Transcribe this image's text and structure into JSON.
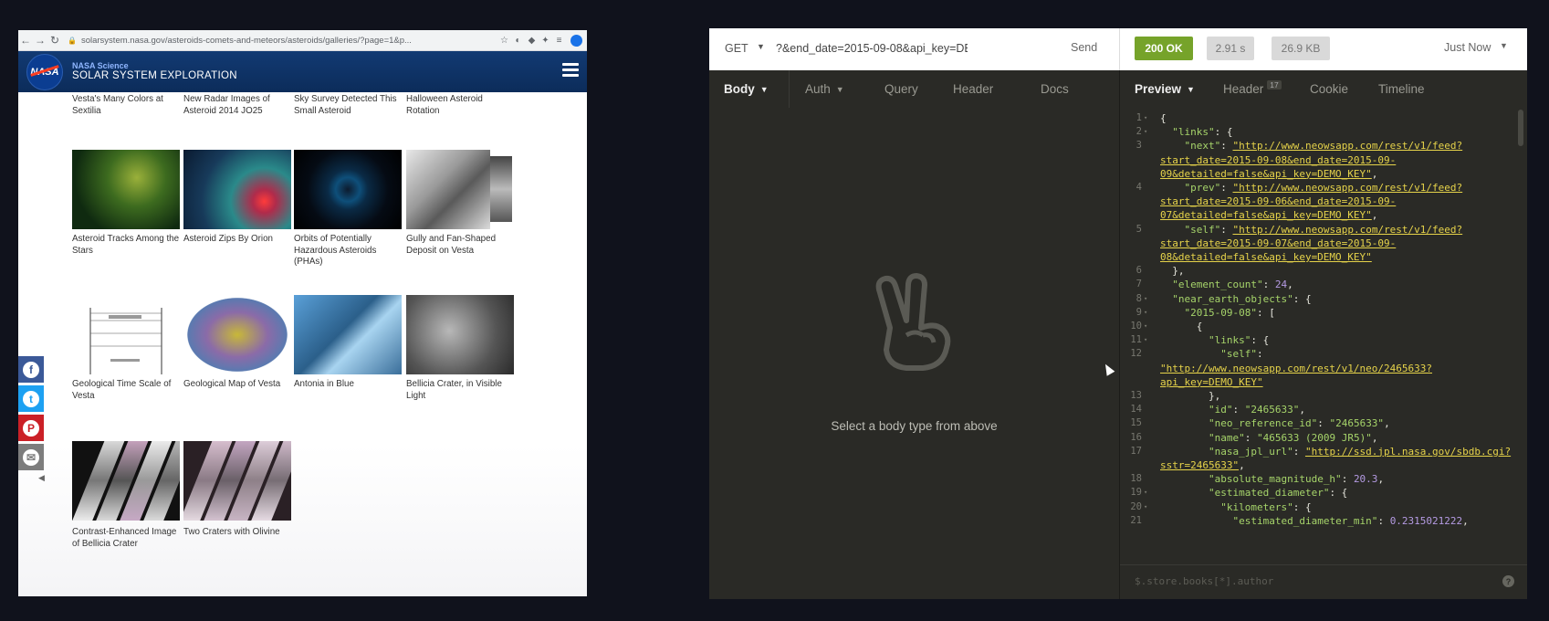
{
  "browser": {
    "url": "solarsystem.nasa.gov/asteroids-comets-and-meteors/asteroids/galleries/?page=1&p...",
    "nasa_kicker": "NASA Science",
    "site_title": "SOLAR SYSTEM EXPLORATION",
    "logo_text": "NASA",
    "top_captions": [
      "Vesta's Many Colors at Sextilia",
      "New Radar Images of Asteroid 2014 JO25",
      "Sky Survey Detected This Small Asteroid",
      "Halloween Asteroid Rotation"
    ],
    "row1_captions": [
      "Asteroid Tracks Among the Stars",
      "Asteroid Zips By Orion",
      "Orbits of Potentially Hazardous Asteroids (PHAs)",
      "Gully and Fan-Shaped Deposit on Vesta"
    ],
    "row2_captions": [
      "Geological Time Scale of Vesta",
      "Geological Map of Vesta",
      "Antonia in Blue",
      "Bellicia Crater, in Visible Light"
    ],
    "row3_captions": [
      "Contrast-Enhanced Image of Bellicia Crater",
      "Two Craters with Olivine"
    ],
    "share": {
      "facebook": "f",
      "twitter": "t",
      "pinterest": "P",
      "email": "✉",
      "collapse": "◀"
    },
    "colors": {
      "facebook": "#3b5998",
      "twitter": "#1da1f2",
      "pinterest": "#cb2027",
      "email": "#7d7d7d"
    }
  },
  "insomnia": {
    "method": "GET",
    "url": "?&end_date=2015-09-08&api_key=DEMO_KEY",
    "send": "Send",
    "status": "200 OK",
    "time": "2.91 s",
    "size": "26.9 KB",
    "timestamp": "Just Now",
    "request_tabs": [
      "Body",
      "Auth",
      "Query",
      "Header",
      "Docs"
    ],
    "response_tabs": [
      "Preview",
      "Header",
      "Cookie",
      "Timeline"
    ],
    "header_count": "17",
    "empty_message": "Select a body type from above",
    "filter_placeholder": "$.store.books[*].author",
    "help": "?",
    "colors": {
      "status_ok": "#76a32a",
      "json_key": "#a6d46a",
      "json_link": "#e6d34a",
      "json_number": "#b59be3"
    },
    "json_lines": [
      {
        "n": "1",
        "fold": "▾",
        "html": "{"
      },
      {
        "n": "2",
        "fold": "▾",
        "html": "  <span class='k'>\"links\"</span>: {"
      },
      {
        "n": "3",
        "fold": "",
        "html": "    <span class='k'>\"next\"</span>: <span class='u'>\"http://www.neowsapp.com/rest/v1/feed?</span>"
      },
      {
        "n": "",
        "fold": "",
        "html": "<span class='u'>start_date=2015-09-08&end_date=2015-09-</span>"
      },
      {
        "n": "",
        "fold": "",
        "html": "<span class='u'>09&detailed=false&api_key=DEMO_KEY\"</span>,"
      },
      {
        "n": "4",
        "fold": "",
        "html": "    <span class='k'>\"prev\"</span>: <span class='u'>\"http://www.neowsapp.com/rest/v1/feed?</span>"
      },
      {
        "n": "",
        "fold": "",
        "html": "<span class='u'>start_date=2015-09-06&end_date=2015-09-</span>"
      },
      {
        "n": "",
        "fold": "",
        "html": "<span class='u'>07&detailed=false&api_key=DEMO_KEY\"</span>,"
      },
      {
        "n": "5",
        "fold": "",
        "html": "    <span class='k'>\"self\"</span>: <span class='u'>\"http://www.neowsapp.com/rest/v1/feed?</span>"
      },
      {
        "n": "",
        "fold": "",
        "html": "<span class='u'>start_date=2015-09-07&end_date=2015-09-</span>"
      },
      {
        "n": "",
        "fold": "",
        "html": "<span class='u'>08&detailed=false&api_key=DEMO_KEY\"</span>"
      },
      {
        "n": "6",
        "fold": "",
        "html": "  },"
      },
      {
        "n": "7",
        "fold": "",
        "html": "  <span class='k'>\"element_count\"</span>: <span class='n'>24</span>,"
      },
      {
        "n": "8",
        "fold": "▾",
        "html": "  <span class='k'>\"near_earth_objects\"</span>: {"
      },
      {
        "n": "9",
        "fold": "▾",
        "html": "    <span class='s'>\"2015-09-08\"</span>: ["
      },
      {
        "n": "10",
        "fold": "▾",
        "html": "      {"
      },
      {
        "n": "11",
        "fold": "▾",
        "html": "        <span class='k'>\"links\"</span>: {"
      },
      {
        "n": "12",
        "fold": "",
        "html": "          <span class='k'>\"self\"</span>:"
      },
      {
        "n": "",
        "fold": "",
        "html": "<span class='u'>\"http://www.neowsapp.com/rest/v1/neo/2465633?</span>"
      },
      {
        "n": "",
        "fold": "",
        "html": "<span class='u'>api_key=DEMO_KEY\"</span>"
      },
      {
        "n": "13",
        "fold": "",
        "html": "        },"
      },
      {
        "n": "14",
        "fold": "",
        "html": "        <span class='k'>\"id\"</span>: <span class='s'>\"2465633\"</span>,"
      },
      {
        "n": "15",
        "fold": "",
        "html": "        <span class='k'>\"neo_reference_id\"</span>: <span class='s'>\"2465633\"</span>,"
      },
      {
        "n": "16",
        "fold": "",
        "html": "        <span class='k'>\"name\"</span>: <span class='s'>\"465633 (2009 JR5)\"</span>,"
      },
      {
        "n": "17",
        "fold": "",
        "html": "        <span class='k'>\"nasa_jpl_url\"</span>: <span class='u'>\"http://ssd.jpl.nasa.gov/sbdb.cgi?</span>"
      },
      {
        "n": "",
        "fold": "",
        "html": "<span class='u'>sstr=2465633\"</span>,"
      },
      {
        "n": "18",
        "fold": "",
        "html": "        <span class='k'>\"absolute_magnitude_h\"</span>: <span class='n'>20.3</span>,"
      },
      {
        "n": "19",
        "fold": "▾",
        "html": "        <span class='k'>\"estimated_diameter\"</span>: {"
      },
      {
        "n": "20",
        "fold": "▾",
        "html": "          <span class='k'>\"kilometers\"</span>: {"
      },
      {
        "n": "21",
        "fold": "",
        "html": "            <span class='k'>\"estimated_diameter_min\"</span>: <span class='n'>0.2315021222</span>,"
      }
    ]
  }
}
